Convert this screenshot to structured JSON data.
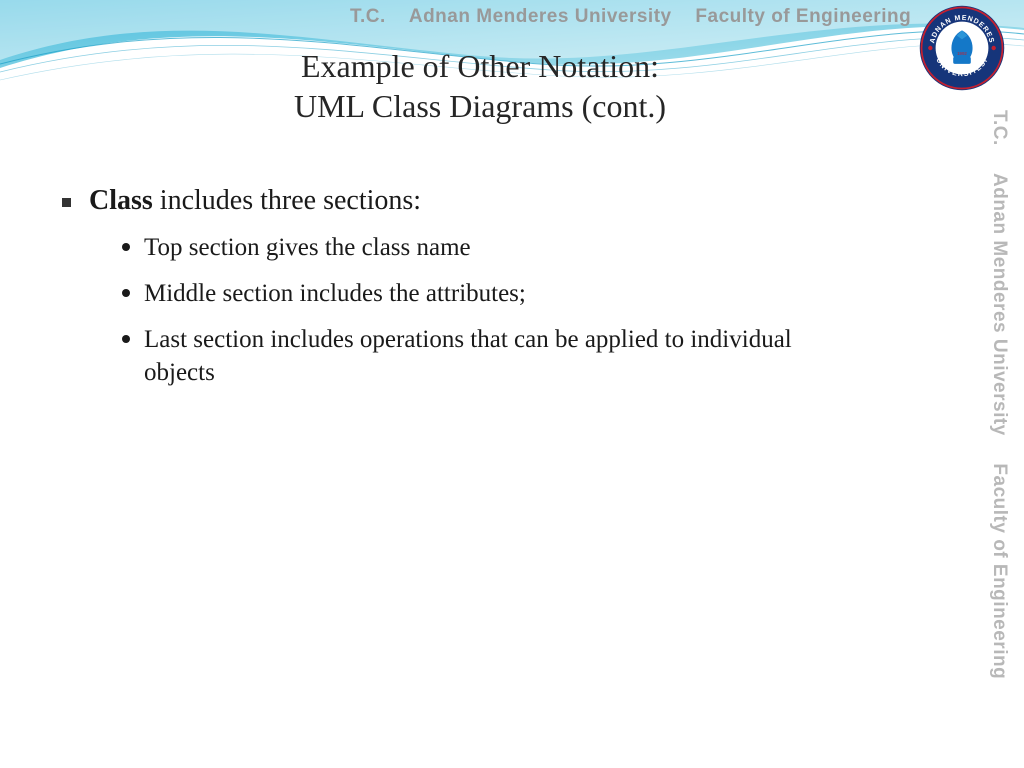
{
  "header": {
    "tc": "T.C.",
    "university": "Adnan Menderes University",
    "faculty": "Faculty of Engineering"
  },
  "logo": {
    "outer_text_top": "ADNAN MENDERES",
    "outer_text_bottom": "ÜNİVERSİTESİ",
    "year": "1992"
  },
  "title": {
    "line1": "Example of Other Notation:",
    "line2": "UML Class Diagrams (cont.)"
  },
  "content": {
    "main": {
      "bold": "Class",
      "rest": " includes three sections:"
    },
    "subs": [
      "Top section gives the class name",
      "Middle section includes the attributes;",
      "Last section includes operations that can be applied to individual objects"
    ]
  }
}
